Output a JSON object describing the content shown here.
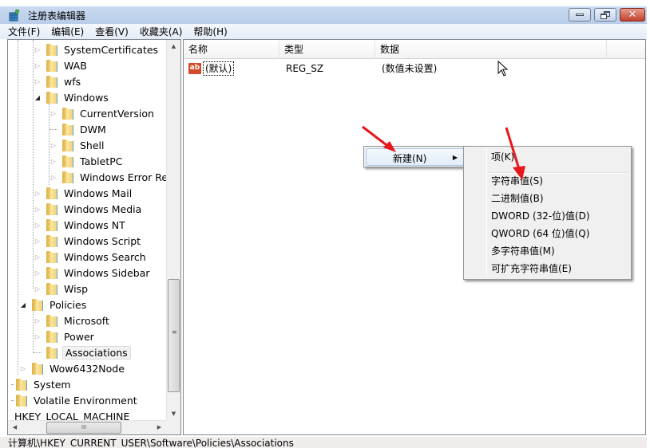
{
  "window": {
    "title": "注册表编辑器",
    "controls": {
      "minimize": "minimize",
      "restore": "restore",
      "close": "✕"
    }
  },
  "menubar": {
    "items": [
      "文件(F)",
      "编辑(E)",
      "查看(V)",
      "收藏夹(A)",
      "帮助(H)"
    ]
  },
  "tree": {
    "items": [
      {
        "label": "SystemCertificates",
        "expander": "collapsed"
      },
      {
        "label": "WAB",
        "expander": "collapsed"
      },
      {
        "label": "wfs",
        "expander": "collapsed"
      },
      {
        "label": "Windows",
        "expander": "expanded"
      },
      {
        "label": "CurrentVersion",
        "expander": "collapsed"
      },
      {
        "label": "DWM",
        "expander": "none"
      },
      {
        "label": "Shell",
        "expander": "collapsed"
      },
      {
        "label": "TabletPC",
        "expander": "collapsed"
      },
      {
        "label": "Windows Error Rep",
        "expander": "collapsed"
      },
      {
        "label": "Windows Mail",
        "expander": "collapsed"
      },
      {
        "label": "Windows Media",
        "expander": "collapsed"
      },
      {
        "label": "Windows NT",
        "expander": "collapsed"
      },
      {
        "label": "Windows Script",
        "expander": "collapsed"
      },
      {
        "label": "Windows Search",
        "expander": "collapsed"
      },
      {
        "label": "Windows Sidebar",
        "expander": "collapsed"
      },
      {
        "label": "Wisp",
        "expander": "collapsed"
      },
      {
        "label": "Policies",
        "expander": "expanded"
      },
      {
        "label": "Microsoft",
        "expander": "collapsed"
      },
      {
        "label": "Power",
        "expander": "collapsed"
      },
      {
        "label": "Associations",
        "expander": "none",
        "selected": true
      },
      {
        "label": "Wow6432Node",
        "expander": "collapsed"
      },
      {
        "label": "System",
        "expander": "none"
      },
      {
        "label": "Volatile Environment",
        "expander": "none"
      },
      {
        "label": "HKEY_LOCAL_MACHINE",
        "expander": "none"
      }
    ]
  },
  "list": {
    "columns": [
      "名称",
      "类型",
      "数据"
    ],
    "rows": [
      {
        "name": "(默认)",
        "type": "REG_SZ",
        "data": "(数值未设置)",
        "icon": "string-value-icon"
      }
    ]
  },
  "context_menu": {
    "item": "新建(N)",
    "submenu": [
      "项(K)",
      "字符串值(S)",
      "二进制值(B)",
      "DWORD (32-位)值(D)",
      "QWORD (64 位)值(Q)",
      "多字符串值(M)",
      "可扩充字符串值(E)"
    ]
  },
  "statusbar": {
    "path": "计算机\\HKEY_CURRENT_USER\\Software\\Policies\\Associations"
  },
  "colors": {
    "annotation_arrow": "#e8171b",
    "selection_border": "#a8c8ea",
    "close_button": "#c2402b"
  }
}
